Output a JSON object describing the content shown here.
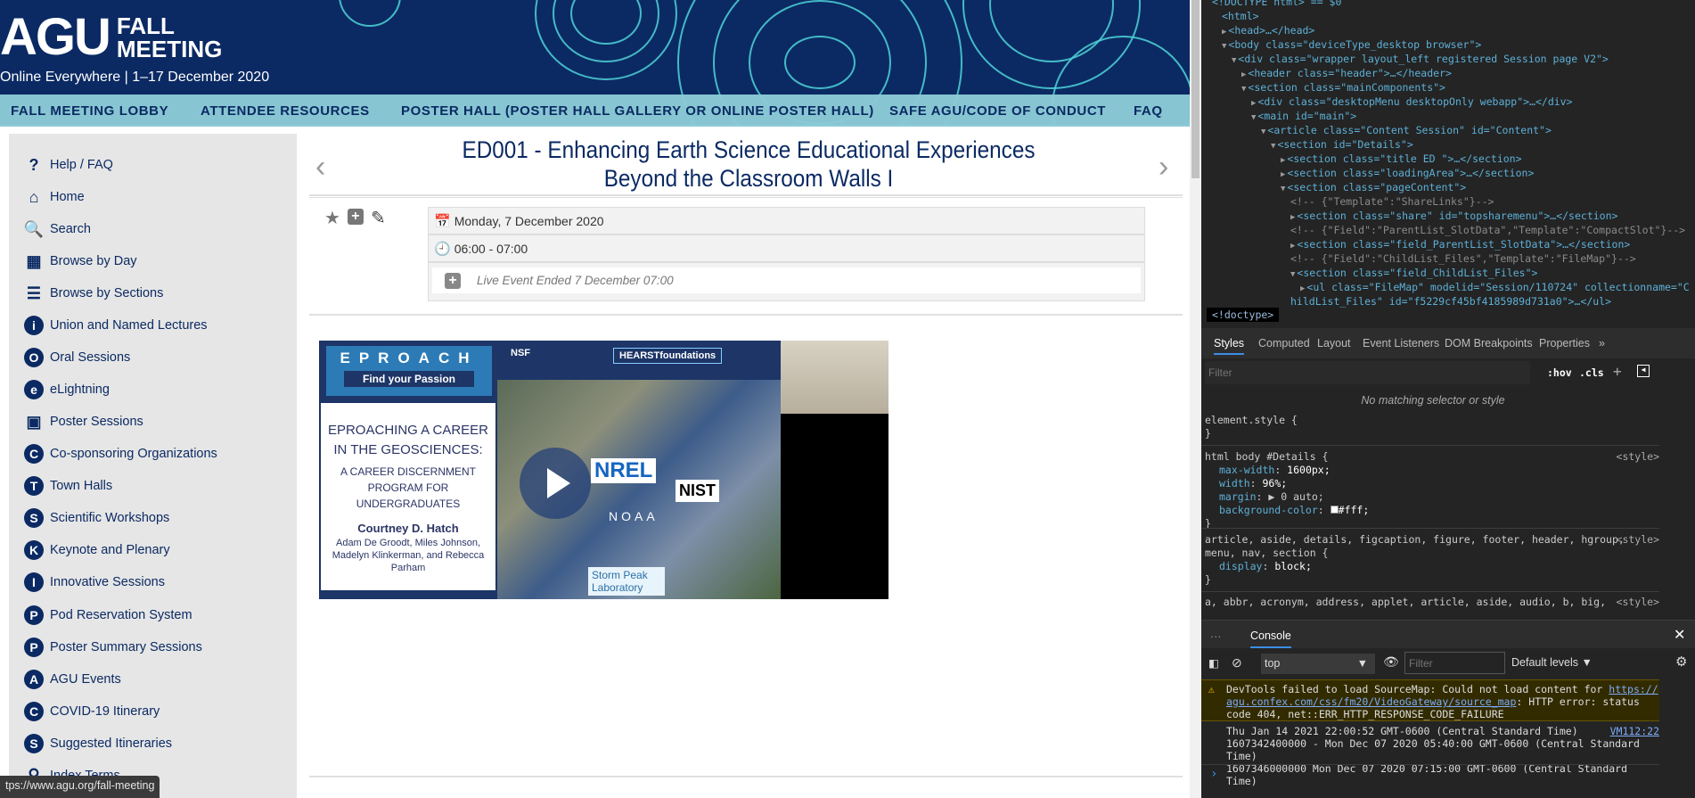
{
  "header": {
    "logo_main": "AGU",
    "logo_line1": "FALL",
    "logo_line2": "MEETING",
    "tagline": "Online Everywhere | 1–17 December 2020",
    "nav": [
      "FALL MEETING LOBBY",
      "ATTENDEE RESOURCES",
      "POSTER HALL (POSTER HALL GALLERY OR ONLINE POSTER HALL)",
      "SAFE AGU/CODE OF CONDUCT",
      "FAQ"
    ]
  },
  "sidebar": {
    "items": [
      {
        "label": "Help / FAQ",
        "icon": "?"
      },
      {
        "label": "Home",
        "icon": "⌂"
      },
      {
        "label": "Search",
        "icon": "🔍"
      },
      {
        "label": "Browse by Day",
        "icon": "▦"
      },
      {
        "label": "Browse by Sections",
        "icon": "☰"
      },
      {
        "label": "Union and Named Lectures",
        "icon": "i"
      },
      {
        "label": "Oral Sessions",
        "icon": "O"
      },
      {
        "label": "eLightning",
        "icon": "e"
      },
      {
        "label": "Poster Sessions",
        "icon": "▣"
      },
      {
        "label": "Co-sponsoring Organizations",
        "icon": "C"
      },
      {
        "label": "Town Halls",
        "icon": "T"
      },
      {
        "label": "Scientific Workshops",
        "icon": "S"
      },
      {
        "label": "Keynote and Plenary",
        "icon": "K"
      },
      {
        "label": "Innovative Sessions",
        "icon": "I"
      },
      {
        "label": "Pod Reservation System",
        "icon": "P"
      },
      {
        "label": "Poster Summary Sessions",
        "icon": "P"
      },
      {
        "label": "AGU Events",
        "icon": "A"
      },
      {
        "label": "COVID-19 Itinerary",
        "icon": "C"
      },
      {
        "label": "Suggested Itineraries",
        "icon": "S"
      },
      {
        "label": "Index Terms",
        "icon": "⚲"
      }
    ]
  },
  "session": {
    "title_line1": "ED001 - Enhancing Earth Science Educational Experiences",
    "title_line2": "Beyond the Classroom Walls I",
    "date": "Monday, 7 December 2020",
    "time": "06:00 - 07:00",
    "live_status": "Live Event Ended 7 December 07:00"
  },
  "video": {
    "epro": "EPROACH",
    "tagline": "Find your Passion",
    "slide_title": "EPROACHING A CAREER IN THE GEOSCIENCES:",
    "slide_subtitle": "A CAREER DISCERNMENT PROGRAM FOR UNDERGRADUATES",
    "presenter": "Courtney D. Hatch",
    "coauthors": "Adam De Groodt, Miles Johnson, Madelyn Klinkerman, and Rebecca Parham",
    "logos": [
      "NSF",
      "HEARSTfoundations",
      "NREL",
      "NIST",
      "NOAA",
      "Storm Peak Laboratory"
    ]
  },
  "status_url": "tps://www.agu.org/fall-meeting",
  "devtools": {
    "dom": [
      {
        "d": 0,
        "t": "<!DOCTYPE html> == $0"
      },
      {
        "d": 1,
        "t": "<html>"
      },
      {
        "d": 1,
        "tri": "▶",
        "t": "<head>…</head>"
      },
      {
        "d": 1,
        "tri": "▼",
        "t": "<body class=\"deviceType_desktop browser\">"
      },
      {
        "d": 2,
        "tri": "▼",
        "t": "<div class=\"wrapper layout_left   registered Session page V2\">"
      },
      {
        "d": 3,
        "tri": "▶",
        "t": "<header class=\"header\">…</header>"
      },
      {
        "d": 3,
        "tri": "▼",
        "t": "<section class=\"mainComponents\">"
      },
      {
        "d": 4,
        "tri": "▶",
        "t": "<div class=\"desktopMenu desktopOnly webapp\">…</div>"
      },
      {
        "d": 4,
        "tri": "▼",
        "t": "<main id=\"main\">"
      },
      {
        "d": 5,
        "tri": "▼",
        "t": "<article class=\"Content Session\" id=\"Content\">"
      },
      {
        "d": 6,
        "tri": "▼",
        "t": "<section id=\"Details\">"
      },
      {
        "d": 7,
        "tri": "▶",
        "t": "<section class=\"title ED    \">…</section>"
      },
      {
        "d": 7,
        "tri": "▶",
        "t": "<section class=\"loadingArea\">…</section>"
      },
      {
        "d": 7,
        "tri": "▼",
        "t": "<section class=\"pageContent\">"
      },
      {
        "d": 8,
        "c": true,
        "t": "<!-- {\"Template\":\"ShareLinks\"}-->"
      },
      {
        "d": 8,
        "tri": "▶",
        "t": "<section class=\"share\" id=\"topsharemenu\">…</section>"
      },
      {
        "d": 8,
        "c": true,
        "t": "<!-- {\"Field\":\"ParentList_SlotData\",\"Template\":\"CompactSlot\"}-->"
      },
      {
        "d": 8,
        "tri": "▶",
        "t": "<section class=\"field_ParentList_SlotData\">…</section>"
      },
      {
        "d": 8,
        "c": true,
        "t": "<!-- {\"Field\":\"ChildList_Files\",\"Template\":\"FileMap\"}-->"
      },
      {
        "d": 8,
        "tri": "▼",
        "t": "<section class=\"field_ChildList_Files\">"
      },
      {
        "d": 9,
        "tri": "▶",
        "t": "<ul class=\"FileMap\" modelid=\"Session/110724\" collectionname=\"C"
      },
      {
        "d": 8,
        "t": "hildList_Files\" id=\"f5229cf45bf4185989d731a0\">…</ul>"
      }
    ],
    "breadcrumb": "<!doctype>",
    "style_tabs": [
      "Styles",
      "Computed",
      "Layout",
      "Event Listeners",
      "DOM Breakpoints",
      "Properties",
      "»"
    ],
    "filter_placeholder": "Filter",
    "hov": ":hov",
    "cls": ".cls",
    "no_match": "No matching selector or style",
    "rules": {
      "element_style": "element.style {",
      "close": "}",
      "details_sel": "html body #Details {",
      "src": "<style>",
      "p1": "max-width",
      "v1": "1600px;",
      "p2": "width",
      "v2": "96%;",
      "p3": "margin",
      "v3": "▶ 0 auto;",
      "p4": "background-color",
      "v4": "#fff;",
      "block_sel1": "article, aside, details, figcaption, figure, footer, header, hgroup,",
      "block_sel2": "menu, nav, section {",
      "p5": "display",
      "v5": "block;",
      "a_sel": "a, abbr, acronym, address, applet, article, aside, audio, b, big,"
    },
    "console": {
      "tab": "Console",
      "context": "top",
      "filter_placeholder": "Filter",
      "levels": "Default levels ▼",
      "warning_pre": "DevTools failed to load SourceMap: Could not load content for ",
      "warning_link": "https://agu.confex.com/css/fm20/VideoGateway/source_map",
      "warning_post": ": HTTP error: status code 404, net::ERR_HTTP_RESPONSE_CODE_FAILURE",
      "log1": "Thu Jan 14 2021 22:00:52 GMT-0600 (Central Standard Time)",
      "log_src": "VM112:22",
      "log2": "1607342400000 - Mon Dec 07 2020 05:40:00 GMT-0600 (Central Standard Time)",
      "log3": "1607346000000 Mon Dec 07 2020 07:15:00 GMT-0600 (Central Standard Time)",
      "prompt": "›"
    }
  },
  "colors": {
    "navy": "#0b2a63",
    "teal_nav": "#8ccbd6",
    "ring": "#4fd3d8",
    "sidebar_bg": "#e6e6e6",
    "devtools_bg": "#242424"
  }
}
